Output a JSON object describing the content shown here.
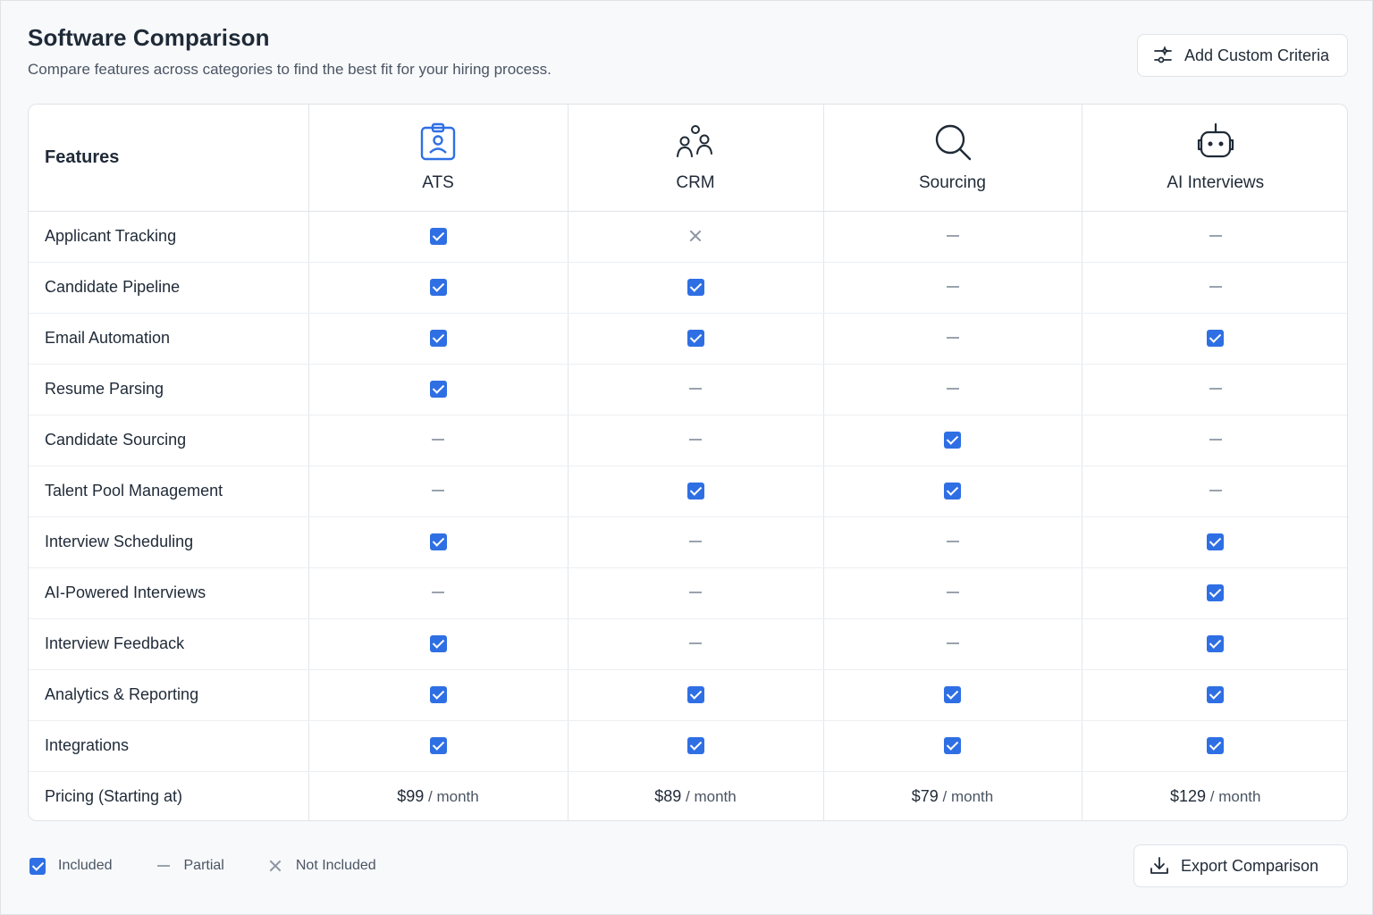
{
  "header": {
    "title": "Software Comparison",
    "subtitle": "Compare features across categories to find the best fit for your hiring process.",
    "add_criteria_label": "Add Custom Criteria"
  },
  "table": {
    "features_header": "Features",
    "categories": [
      {
        "label": "ATS",
        "icon": "badge-icon"
      },
      {
        "label": "CRM",
        "icon": "users-icon"
      },
      {
        "label": "Sourcing",
        "icon": "search-icon"
      },
      {
        "label": "AI Interviews",
        "icon": "robot-icon"
      }
    ],
    "rows": [
      {
        "feature": "Applicant Tracking",
        "values": [
          "included",
          "not_included",
          "partial",
          "partial"
        ]
      },
      {
        "feature": "Candidate Pipeline",
        "values": [
          "included",
          "included",
          "partial",
          "partial"
        ]
      },
      {
        "feature": "Email Automation",
        "values": [
          "included",
          "included",
          "partial",
          "included"
        ]
      },
      {
        "feature": "Resume Parsing",
        "values": [
          "included",
          "partial",
          "partial",
          "partial"
        ]
      },
      {
        "feature": "Candidate Sourcing",
        "values": [
          "partial",
          "partial",
          "included",
          "partial"
        ]
      },
      {
        "feature": "Talent Pool Management",
        "values": [
          "partial",
          "included",
          "included",
          "partial"
        ]
      },
      {
        "feature": "Interview Scheduling",
        "values": [
          "included",
          "partial",
          "partial",
          "included"
        ]
      },
      {
        "feature": "AI-Powered Interviews",
        "values": [
          "partial",
          "partial",
          "partial",
          "included"
        ]
      },
      {
        "feature": "Interview Feedback",
        "values": [
          "included",
          "partial",
          "partial",
          "included"
        ]
      },
      {
        "feature": "Analytics & Reporting",
        "values": [
          "included",
          "included",
          "included",
          "included"
        ]
      },
      {
        "feature": "Integrations",
        "values": [
          "included",
          "included",
          "included",
          "included"
        ]
      }
    ],
    "pricing": {
      "label": "Pricing (Starting at)",
      "prices": [
        {
          "amount": "$99",
          "period": "/ month"
        },
        {
          "amount": "$89",
          "period": "/ month"
        },
        {
          "amount": "$79",
          "period": "/ month"
        },
        {
          "amount": "$129",
          "period": "/ month"
        }
      ]
    }
  },
  "legend": {
    "included": "Included",
    "partial": "Partial",
    "not_included": "Not Included"
  },
  "footer": {
    "export_label": "Export Comparison"
  },
  "colors": {
    "accent": "#2f6fe4",
    "text": "#1f2a37",
    "muted": "#4a5563"
  }
}
